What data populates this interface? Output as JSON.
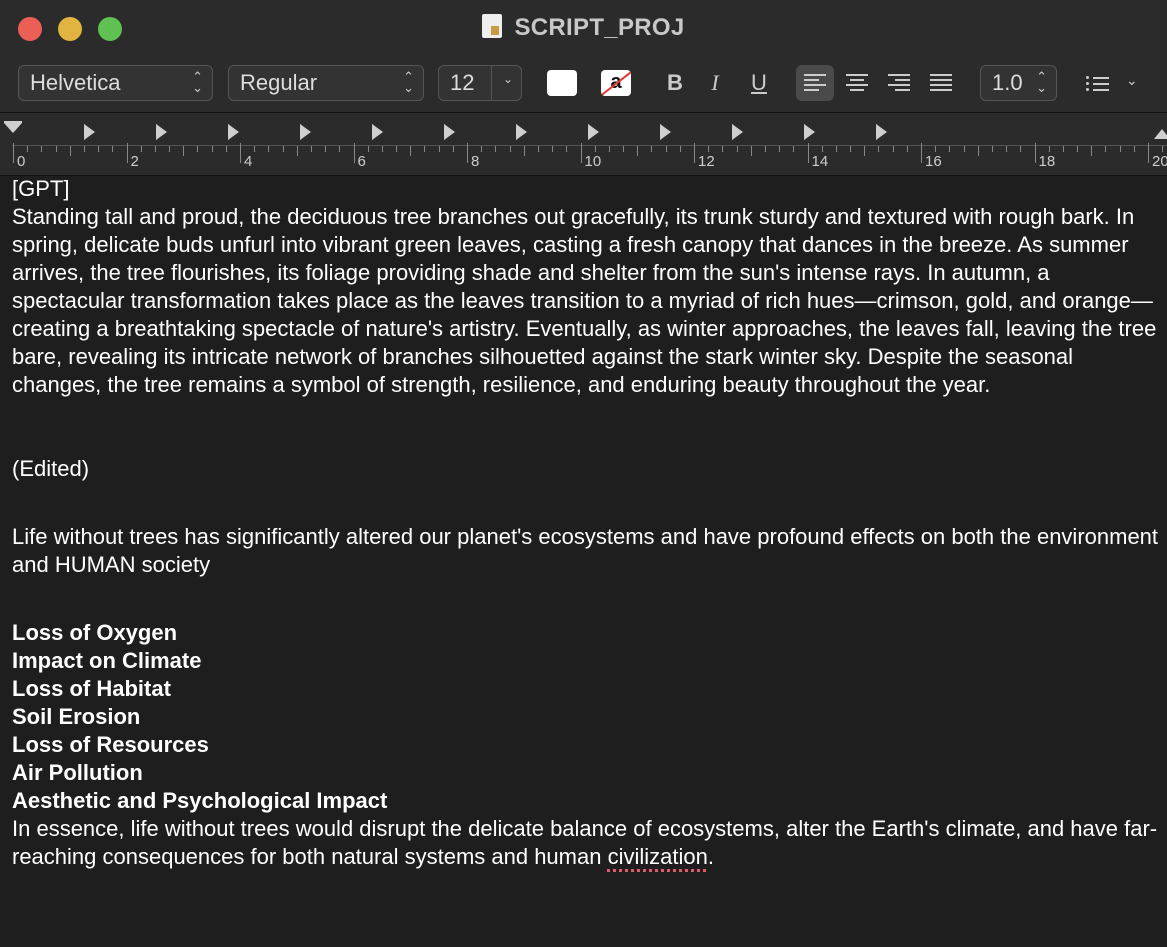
{
  "window": {
    "title": "SCRIPT_PROJ"
  },
  "toolbar": {
    "font_family": "Helvetica",
    "font_style": "Regular",
    "font_size": "12",
    "text_color": "#ffffff",
    "background_swatch_letter": "a",
    "bold_label": "B",
    "italic_label": "I",
    "underline_label": "U",
    "line_spacing": "1.0",
    "alignment_active": "left",
    "icons": [
      "document-icon",
      "text-color-icon",
      "highlight-icon",
      "align-left-icon",
      "align-center-icon",
      "align-right-icon",
      "justify-icon",
      "list-icon",
      "chevron-down-icon"
    ]
  },
  "ruler": {
    "labels": [
      "0",
      "2",
      "4",
      "6",
      "8",
      "10",
      "12",
      "14",
      "16",
      "18",
      "20"
    ]
  },
  "document": {
    "heading": "[GPT]",
    "paragraph1": "Standing tall and proud, the deciduous tree branches out gracefully, its trunk sturdy and textured with rough bark. In spring, delicate buds unfurl into vibrant green leaves, casting a fresh canopy that dances in the breeze. As summer arrives, the tree flourishes, its foliage providing shade and shelter from the sun's intense rays. In autumn, a spectacular transformation takes place as the leaves transition to a myriad of rich hues—crimson, gold, and orange—creating a breathtaking spectacle of nature's artistry. Eventually, as winter approaches, the leaves fall, leaving the tree bare, revealing its intricate network of branches silhouetted against the stark winter sky. Despite the seasonal changes, the tree remains a symbol of strength, resilience, and enduring beauty throughout the year.",
    "edited_label": "(Edited)",
    "paragraph2": "Life without trees has significantly altered our planet's ecosystems and have profound effects on both the environment and HUMAN society",
    "bold_items": [
      "Loss of Oxygen",
      "Impact on Climate",
      "Loss of Habitat",
      "Soil Erosion",
      "Loss of Resources",
      "Air Pollution",
      "Aesthetic and Psychological Impact"
    ],
    "conclusion_before": "In essence, life without trees would disrupt the delicate balance of ecosystems, alter the Earth's climate, and have far-reaching consequences for both natural systems and human ",
    "conclusion_misspelled": "civilization",
    "conclusion_after": "."
  }
}
